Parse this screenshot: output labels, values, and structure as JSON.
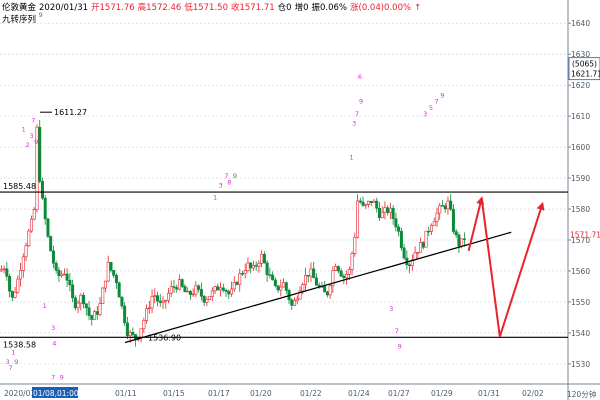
{
  "header": {
    "symbol": "伦敦黄金",
    "date": "2020/01/31",
    "open": "开1571.76",
    "high": "高1572.46",
    "low": "低1571.50",
    "close": "收1571.71",
    "pos": "仓0",
    "inc": "增0",
    "amp": "振0.06%",
    "chg": "涨(0.04)0.00%",
    "arrow": "↑",
    "indicator": "九转序列"
  },
  "colors": {
    "up": "#e8232a",
    "down": "#0a8a3a",
    "magenta": "#d92ad9",
    "green_td": "#2aa02a",
    "line": "#000000",
    "arrow": "#e8232a",
    "grid": "#c8d2dc",
    "axis_text": "#505a64"
  },
  "chart_data": {
    "type": "candlestick",
    "y_ticks": [
      1530,
      1540,
      1550,
      1560,
      1570,
      1580,
      1590,
      1600,
      1610,
      1620,
      1630,
      1640
    ],
    "ylim": [
      1523.5,
      1647.5
    ],
    "x_ticks": [
      "2020/01",
      "01/08,01:00",
      "01/11",
      "01/15",
      "01/17",
      "01/20",
      "01/22",
      "01/24",
      "01/27",
      "01/29",
      "01/31",
      "02/02"
    ],
    "x_axis_right_label": "120分钟",
    "current_price": "1571.71",
    "badge_top": "(5065)",
    "badge_bottom": "1621.71",
    "level_labels": [
      {
        "text": "1611.27",
        "value": 1611.27
      },
      {
        "text": "1585.48",
        "value": 1585.48
      },
      {
        "text": "1538.58",
        "value": 1538.58
      },
      {
        "text": "1536.90",
        "value": 1536.9
      }
    ],
    "horizontal_lines": [
      1585.48,
      1538.58
    ],
    "trendline": [
      {
        "x": 0.22,
        "y": 1536.9
      },
      {
        "x": 0.9,
        "y": 1572.5
      }
    ],
    "forecast_path": [
      {
        "x": 0.825,
        "y": 1566.5
      },
      {
        "x": 0.848,
        "y": 1583.5
      },
      {
        "x": 0.88,
        "y": 1538.8
      },
      {
        "x": 0.955,
        "y": 1581.7
      }
    ],
    "price_path": [
      [
        0.0,
        1560
      ],
      [
        0.01,
        1562
      ],
      [
        0.02,
        1550
      ],
      [
        0.03,
        1556
      ],
      [
        0.04,
        1565
      ],
      [
        0.05,
        1572
      ],
      [
        0.06,
        1578
      ],
      [
        0.065,
        1606
      ],
      [
        0.07,
        1590
      ],
      [
        0.075,
        1582
      ],
      [
        0.085,
        1570
      ],
      [
        0.1,
        1558
      ],
      [
        0.115,
        1560
      ],
      [
        0.13,
        1549
      ],
      [
        0.145,
        1552
      ],
      [
        0.16,
        1544
      ],
      [
        0.175,
        1548
      ],
      [
        0.19,
        1562
      ],
      [
        0.205,
        1557
      ],
      [
        0.215,
        1548
      ],
      [
        0.225,
        1540
      ],
      [
        0.24,
        1538
      ],
      [
        0.255,
        1545
      ],
      [
        0.27,
        1553
      ],
      [
        0.285,
        1548
      ],
      [
        0.3,
        1554
      ],
      [
        0.315,
        1556
      ],
      [
        0.33,
        1552
      ],
      [
        0.345,
        1554
      ],
      [
        0.36,
        1551
      ],
      [
        0.375,
        1553
      ],
      [
        0.39,
        1556
      ],
      [
        0.405,
        1552
      ],
      [
        0.42,
        1558
      ],
      [
        0.435,
        1562
      ],
      [
        0.445,
        1560
      ],
      [
        0.46,
        1565
      ],
      [
        0.47,
        1560
      ],
      [
        0.485,
        1554
      ],
      [
        0.5,
        1556
      ],
      [
        0.515,
        1548
      ],
      [
        0.53,
        1556
      ],
      [
        0.545,
        1560
      ],
      [
        0.56,
        1555
      ],
      [
        0.575,
        1552
      ],
      [
        0.59,
        1563
      ],
      [
        0.605,
        1558
      ],
      [
        0.615,
        1560
      ],
      [
        0.625,
        1572
      ],
      [
        0.63,
        1584
      ],
      [
        0.64,
        1580
      ],
      [
        0.655,
        1583
      ],
      [
        0.67,
        1578
      ],
      [
        0.685,
        1580
      ],
      [
        0.7,
        1574
      ],
      [
        0.71,
        1566
      ],
      [
        0.72,
        1562
      ],
      [
        0.73,
        1566
      ],
      [
        0.745,
        1569
      ],
      [
        0.76,
        1576
      ],
      [
        0.775,
        1580
      ],
      [
        0.79,
        1582
      ],
      [
        0.8,
        1572
      ],
      [
        0.81,
        1568
      ],
      [
        0.82,
        1571.71
      ]
    ],
    "td_labels": [
      {
        "text": "9",
        "x": 0.068,
        "y": 1642,
        "color": "green"
      },
      {
        "text": "1",
        "x": 0.038,
        "y": 1605,
        "color": "magenta"
      },
      {
        "text": "2",
        "x": 0.045,
        "y": 1600,
        "color": "magenta"
      },
      {
        "text": "3",
        "x": 0.052,
        "y": 1603,
        "color": "magenta"
      },
      {
        "text": "7",
        "x": 0.055,
        "y": 1608,
        "color": "magenta"
      },
      {
        "text": "9",
        "x": 0.06,
        "y": 1601,
        "color": "magenta"
      },
      {
        "text": "1",
        "x": 0.02,
        "y": 1533,
        "color": "magenta"
      },
      {
        "text": "3",
        "x": 0.01,
        "y": 1530,
        "color": "magenta"
      },
      {
        "text": "7",
        "x": 0.015,
        "y": 1528,
        "color": "magenta"
      },
      {
        "text": "9",
        "x": 0.025,
        "y": 1530,
        "color": "magenta"
      },
      {
        "text": "7",
        "x": 0.09,
        "y": 1525,
        "color": "magenta"
      },
      {
        "text": "9",
        "x": 0.105,
        "y": 1525,
        "color": "magenta"
      },
      {
        "text": "1",
        "x": 0.075,
        "y": 1548,
        "color": "magenta"
      },
      {
        "text": "3",
        "x": 0.09,
        "y": 1541,
        "color": "magenta"
      },
      {
        "text": "4",
        "x": 0.092,
        "y": 1536,
        "color": "magenta"
      },
      {
        "text": "1",
        "x": 0.375,
        "y": 1583,
        "color": "magenta"
      },
      {
        "text": "3",
        "x": 0.385,
        "y": 1587,
        "color": "magenta"
      },
      {
        "text": "7",
        "x": 0.395,
        "y": 1590,
        "color": "magenta"
      },
      {
        "text": "8",
        "x": 0.4,
        "y": 1588,
        "color": "magenta"
      },
      {
        "text": "9",
        "x": 0.41,
        "y": 1590,
        "color": "green"
      },
      {
        "text": "1",
        "x": 0.615,
        "y": 1596,
        "color": "magenta"
      },
      {
        "text": "3",
        "x": 0.62,
        "y": 1607,
        "color": "magenta"
      },
      {
        "text": "7",
        "x": 0.625,
        "y": 1610,
        "color": "magenta"
      },
      {
        "text": "6",
        "x": 0.63,
        "y": 1622,
        "color": "magenta"
      },
      {
        "text": "9",
        "x": 0.632,
        "y": 1614,
        "color": "magenta"
      },
      {
        "text": "3",
        "x": 0.745,
        "y": 1610,
        "color": "magenta"
      },
      {
        "text": "5",
        "x": 0.755,
        "y": 1612,
        "color": "magenta"
      },
      {
        "text": "7",
        "x": 0.765,
        "y": 1614,
        "color": "magenta"
      },
      {
        "text": "9",
        "x": 0.775,
        "y": 1616,
        "color": "magenta"
      },
      {
        "text": "3",
        "x": 0.685,
        "y": 1547,
        "color": "magenta"
      },
      {
        "text": "7",
        "x": 0.695,
        "y": 1540,
        "color": "magenta"
      },
      {
        "text": "9",
        "x": 0.7,
        "y": 1535,
        "color": "magenta"
      }
    ]
  }
}
